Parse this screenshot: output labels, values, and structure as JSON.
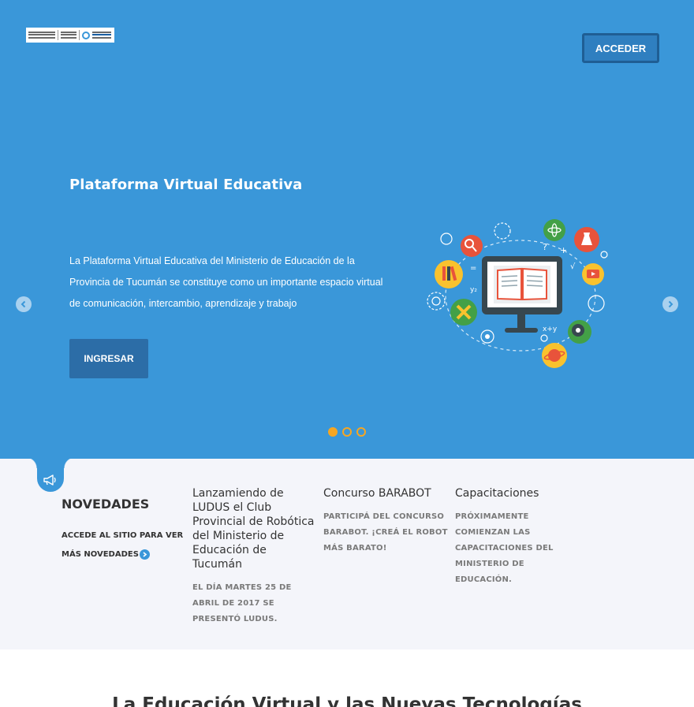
{
  "header": {
    "acceder_label": "ACCEDER"
  },
  "hero": {
    "title": "Plataforma Virtual Educativa",
    "text": "La Plataforma Virtual Educativa del Ministerio de Educación de la Provincia de Tucumán se constituye como un importante espacio virtual de comunicación, intercambio, aprendizaje y trabajo",
    "button_label": "INGRESAR",
    "slides_count": 3,
    "active_slide": 1
  },
  "news": {
    "section_title": "NOVEDADES",
    "section_link": "ACCEDE AL SITIO PARA VER MÁS NOVEDADES",
    "items": [
      {
        "title": "Lanzamiendo de LUDUS el Club Provincial de Robótica del Ministerio de Educación de Tucumán",
        "summary": "EL DÍA MARTES 25 DE ABRIL DE 2017 SE PRESENTÓ LUDUS."
      },
      {
        "title": "Concurso BARABOT",
        "summary": "PARTICIPÁ DEL CONCURSO BARABOT. ¡CREÁ EL ROBOT MÁS BARATO!"
      },
      {
        "title": "Capacitaciones",
        "summary": "PRÓXIMAMENTE COMIENZAN LAS CAPACITACIONES DEL MINISTERIO DE EDUCACIÓN."
      }
    ]
  },
  "bottom": {
    "title": "La Educación Virtual y las Nuevas Tecnologías"
  },
  "colors": {
    "hero_bg": "#3a97d9",
    "accent": "#f5a623",
    "button_dark": "#2c6da7",
    "news_bg": "#f4f5fa"
  },
  "icons": [
    "megaphone-icon",
    "chevron-left-icon",
    "chevron-right-icon",
    "chevron-right-circle-icon"
  ]
}
